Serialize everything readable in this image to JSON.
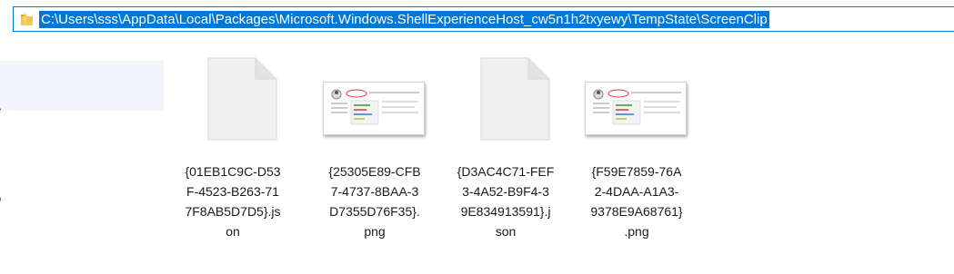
{
  "address_bar": {
    "path": "C:\\Users\\sss\\AppData\\Local\\Packages\\Microsoft.Windows.ShellExperienceHost_cw5n1h2txyewy\\TempState\\ScreenClip",
    "folder_icon": "folder-icon"
  },
  "nav_pane": {
    "items": [
      {
        "label": "e"
      },
      {
        "label": "o"
      }
    ]
  },
  "files": [
    {
      "name": "{01EB1C9C-D53F-4523-B263-717F8AB5D7D5}.json",
      "name_lines": [
        "{01EB1C9C-D53",
        "F-4523-B263-71",
        "7F8AB5D7D5}.js",
        "on"
      ],
      "icon": "document-icon"
    },
    {
      "name": "{25305E89-CFB7-4737-8BAA-3D7355D76F35}.png",
      "name_lines": [
        "{25305E89-CFB",
        "7-4737-8BAA-3",
        "D7355D76F35}.",
        "png"
      ],
      "icon": "image-thumbnail"
    },
    {
      "name": "{D3AC4C71-FEF3-4A52-B9F4-39E834913591}.json",
      "name_lines": [
        "{D3AC4C71-FEF",
        "3-4A52-B9F4-3",
        "9E834913591}.j",
        "son"
      ],
      "icon": "document-icon"
    },
    {
      "name": "{F59E7859-76A2-4DAA-A1A3-9378E9A68761}.png",
      "name_lines": [
        "{F59E7859-76A",
        "2-4DAA-A1A3-",
        "9378E9A68761}",
        ".png"
      ],
      "icon": "image-thumbnail"
    }
  ],
  "colors": {
    "selection": "#0078d7",
    "nav_selected": "#f2f6fa",
    "folder": "#f4c84b"
  }
}
